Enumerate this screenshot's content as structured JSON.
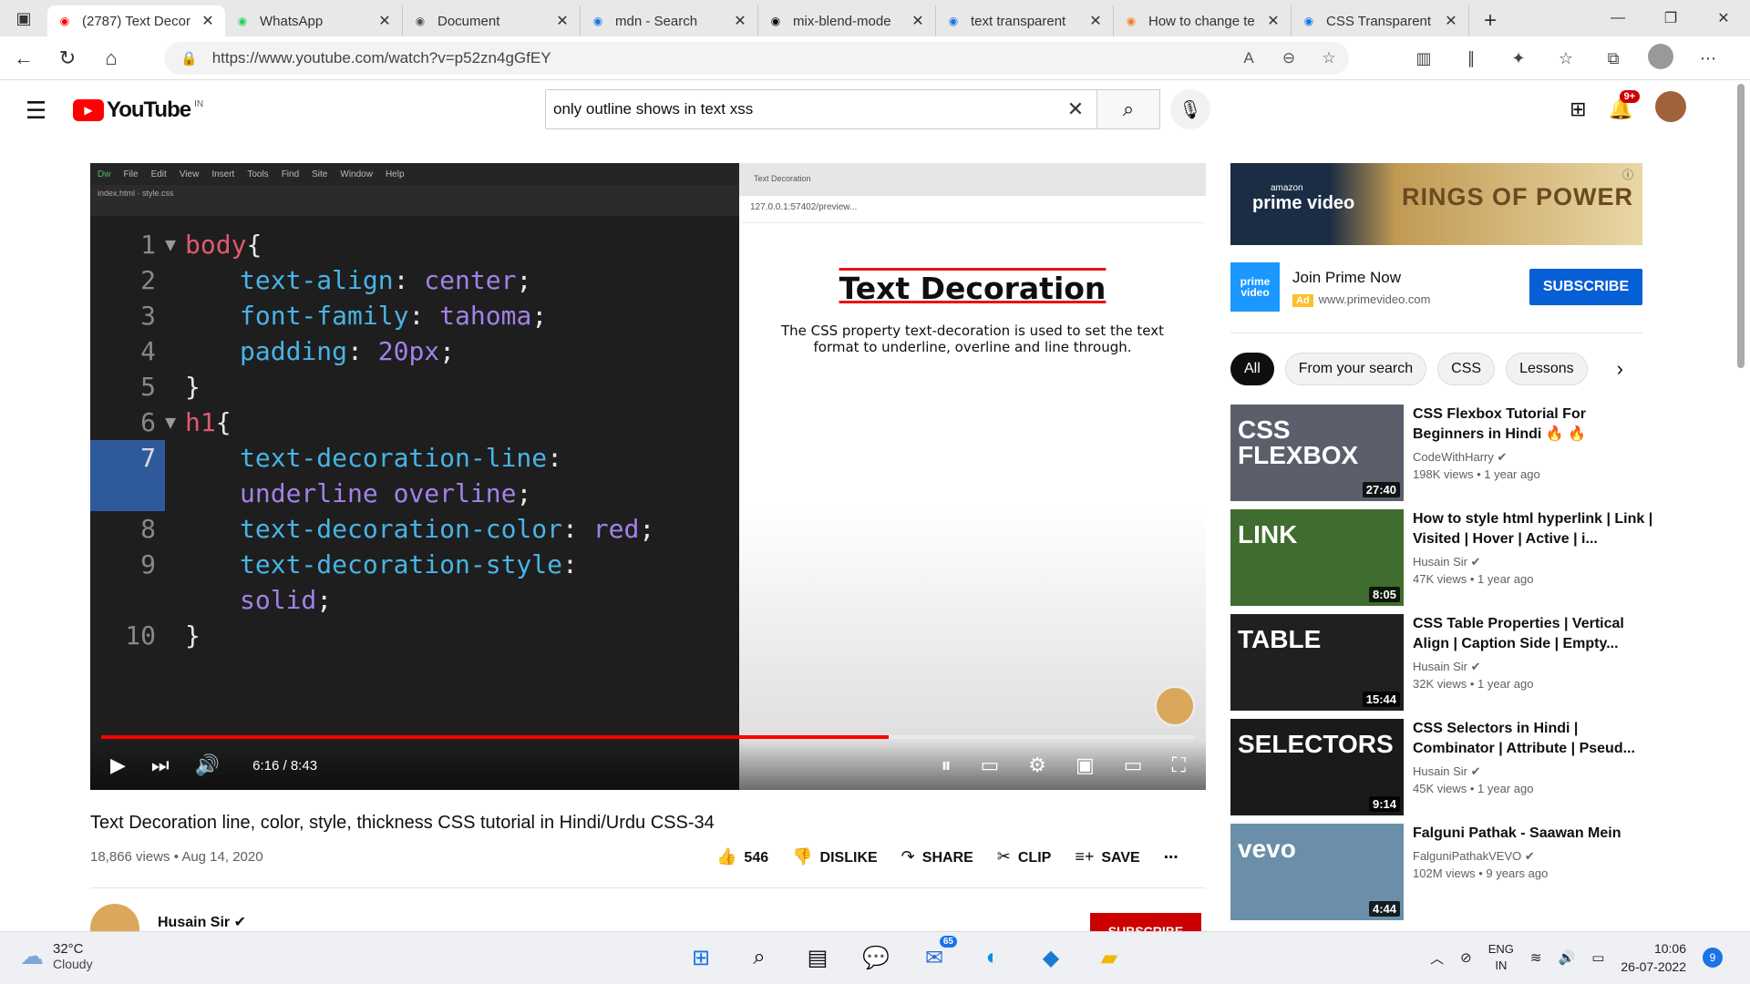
{
  "browser": {
    "tabs": [
      {
        "title": "(2787) Text Decor",
        "icon": "youtube-icon",
        "active": true
      },
      {
        "title": "WhatsApp",
        "icon": "whatsapp-icon",
        "active": false
      },
      {
        "title": "Document",
        "icon": "document-icon",
        "active": false
      },
      {
        "title": "mdn - Search",
        "icon": "search-icon",
        "active": false
      },
      {
        "title": "mix-blend-mode",
        "icon": "mdn-icon",
        "active": false
      },
      {
        "title": "text transparent",
        "icon": "search-icon",
        "active": false
      },
      {
        "title": "How to change te",
        "icon": "stackoverflow-icon",
        "active": false
      },
      {
        "title": "CSS Transparent",
        "icon": "w3-icon",
        "active": false
      }
    ],
    "url": "https://www.youtube.com/watch?v=p52zn4gGfEY"
  },
  "yt": {
    "logo": "YouTube",
    "country": "IN",
    "search_query": "only outline shows in text xss",
    "notif_count": "9+"
  },
  "video": {
    "code_lines": [
      {
        "n": "1",
        "fold": "▼",
        "parts": [
          [
            "sel",
            "body"
          ],
          [
            "pun",
            "{"
          ]
        ],
        "indent": 0
      },
      {
        "n": "2",
        "fold": "",
        "parts": [
          [
            "prop",
            "text-align"
          ],
          [
            "pun",
            ": "
          ],
          [
            "val",
            "center"
          ],
          [
            "pun",
            ";"
          ]
        ],
        "indent": 1
      },
      {
        "n": "3",
        "fold": "",
        "parts": [
          [
            "prop",
            "font-family"
          ],
          [
            "pun",
            ": "
          ],
          [
            "val",
            "tahoma"
          ],
          [
            "pun",
            ";"
          ]
        ],
        "indent": 1
      },
      {
        "n": "4",
        "fold": "",
        "parts": [
          [
            "prop",
            "padding"
          ],
          [
            "pun",
            ": "
          ],
          [
            "val",
            "20px"
          ],
          [
            "pun",
            ";"
          ]
        ],
        "indent": 1
      },
      {
        "n": "5",
        "fold": "",
        "parts": [
          [
            "pun",
            "}"
          ]
        ],
        "indent": 0
      },
      {
        "n": "6",
        "fold": "▼",
        "parts": [
          [
            "sel",
            "h1"
          ],
          [
            "pun",
            "{"
          ]
        ],
        "indent": 0
      },
      {
        "n": "7",
        "fold": "",
        "parts": [
          [
            "prop",
            "text-decoration-line"
          ],
          [
            "pun",
            ":"
          ]
        ],
        "indent": 1,
        "hl": true
      },
      {
        "n": "",
        "fold": "",
        "parts": [
          [
            "val",
            "underline overline"
          ],
          [
            "pun",
            ";"
          ]
        ],
        "indent": 1,
        "hl": true
      },
      {
        "n": "8",
        "fold": "",
        "parts": [
          [
            "prop",
            "text-decoration-color"
          ],
          [
            "pun",
            ": "
          ],
          [
            "val",
            "red"
          ],
          [
            "pun",
            ";"
          ]
        ],
        "indent": 1
      },
      {
        "n": "9",
        "fold": "",
        "parts": [
          [
            "prop",
            "text-decoration-style"
          ],
          [
            "pun",
            ":"
          ]
        ],
        "indent": 1
      },
      {
        "n": "",
        "fold": "",
        "parts": [
          [
            "val",
            "solid"
          ],
          [
            "pun",
            ";"
          ]
        ],
        "indent": 1
      },
      {
        "n": "10",
        "fold": "",
        "parts": [
          [
            "pun",
            "}"
          ]
        ],
        "indent": 0
      }
    ],
    "editor_menu": [
      "Dw",
      "File",
      "Edit",
      "View",
      "Insert",
      "Tools",
      "Find",
      "Site",
      "Window",
      "Help"
    ],
    "preview_tab": "Text Decoration",
    "preview_addr": "127.0.0.1:57402/preview...",
    "preview_h1": "Text Decoration",
    "preview_p": "The CSS property text-decoration is used to set the text format to underline, overline and line through.",
    "time": "6:16 / 8:43",
    "progress": 0.72,
    "title": "Text Decoration line, color, style, thickness CSS tutorial in Hindi/Urdu CSS-34",
    "views_date": "18,866 views • Aug 14, 2020",
    "likes": "546",
    "dislike": "DISLIKE",
    "share": "SHARE",
    "clip": "CLIP",
    "save": "SAVE",
    "channel": "Husain Sir",
    "subscribe": "SUBSCRIBE"
  },
  "ad": {
    "brand_small": "amazon",
    "brand": "prime video",
    "banner_title": "RINGS OF POWER",
    "title": "Join Prime Now",
    "badge": "Ad",
    "url": "www.primevideo.com",
    "cta": "SUBSCRIBE"
  },
  "chips": [
    "All",
    "From your search",
    "CSS",
    "Lessons"
  ],
  "recs": [
    {
      "title": "CSS Flexbox Tutorial For Beginners in Hindi 🔥 🔥",
      "channel": "CodeWithHarry",
      "meta": "198K views • 1 year ago",
      "dur": "27:40",
      "thumb": "CSS FLEXBOX",
      "bg": "#5b5f6b"
    },
    {
      "title": "How to style html hyperlink | Link | Visited | Hover | Active | i...",
      "channel": "Husain Sir",
      "meta": "47K views • 1 year ago",
      "dur": "8:05",
      "thumb": "LINK",
      "bg": "#3f6d2f"
    },
    {
      "title": "CSS Table Properties | Vertical Align | Caption Side | Empty...",
      "channel": "Husain Sir",
      "meta": "32K views • 1 year ago",
      "dur": "15:44",
      "thumb": "TABLE",
      "bg": "#202020"
    },
    {
      "title": "CSS Selectors in Hindi | Combinator | Attribute | Pseud...",
      "channel": "Husain Sir",
      "meta": "45K views • 1 year ago",
      "dur": "9:14",
      "thumb": "SELECTORS",
      "bg": "#1a1a1a"
    },
    {
      "title": "Falguni Pathak - Saawan Mein",
      "channel": "FalguniPathakVEVO",
      "meta": "102M views • 9 years ago",
      "dur": "4:44",
      "thumb": "vevo",
      "bg": "#6b8fa8"
    }
  ],
  "taskbar": {
    "temp": "32°C",
    "weather": "Cloudy",
    "teams_badge": "65",
    "lang1": "ENG",
    "lang2": "IN",
    "time": "10:06",
    "date": "26-07-2022",
    "notif": "9"
  }
}
